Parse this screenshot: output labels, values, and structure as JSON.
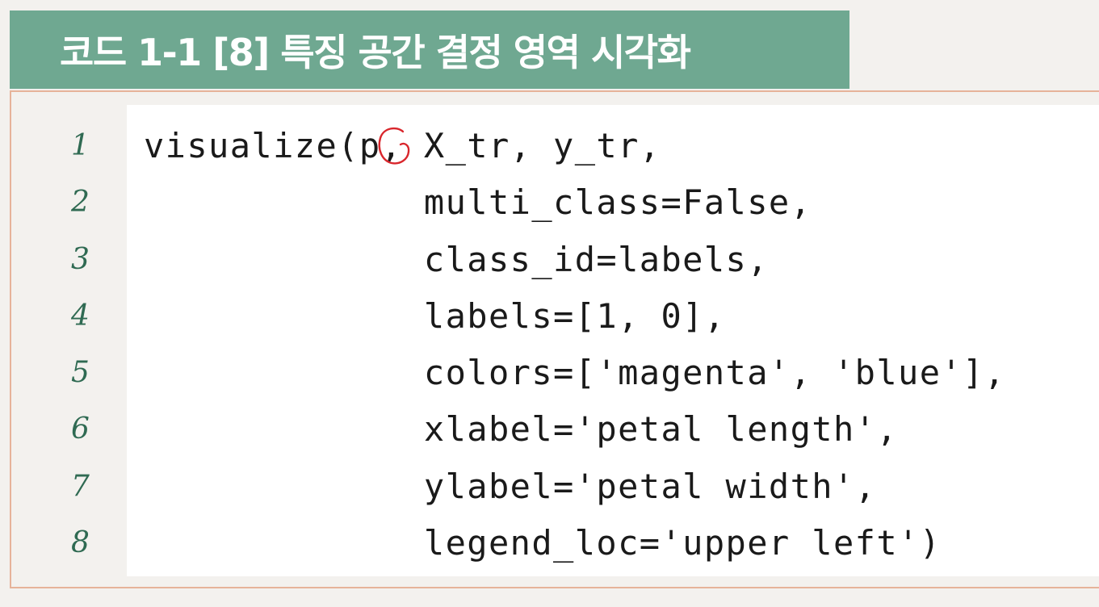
{
  "title": "코드 1-1 [8] 특징 공간 결정 영역 시각화",
  "line_numbers": [
    "1",
    "2",
    "3",
    "4",
    "5",
    "6",
    "7",
    "8"
  ],
  "code_lines": [
    "visualize(p, X_tr, y_tr,",
    "             multi_class=False,",
    "             class_id=labels,",
    "             labels=[1, 0],",
    "             colors=['magenta', 'blue'],",
    "             xlabel='petal length',",
    "             ylabel='petal width',",
    "             legend_loc='upper left')"
  ],
  "colors": {
    "title_bg": "#6fa891",
    "line_number": "#2f6a52",
    "rule": "#e6b39a",
    "annotation": "#d9262c",
    "code_bg": "#ffffff",
    "page_bg": "#f3f1ee"
  }
}
